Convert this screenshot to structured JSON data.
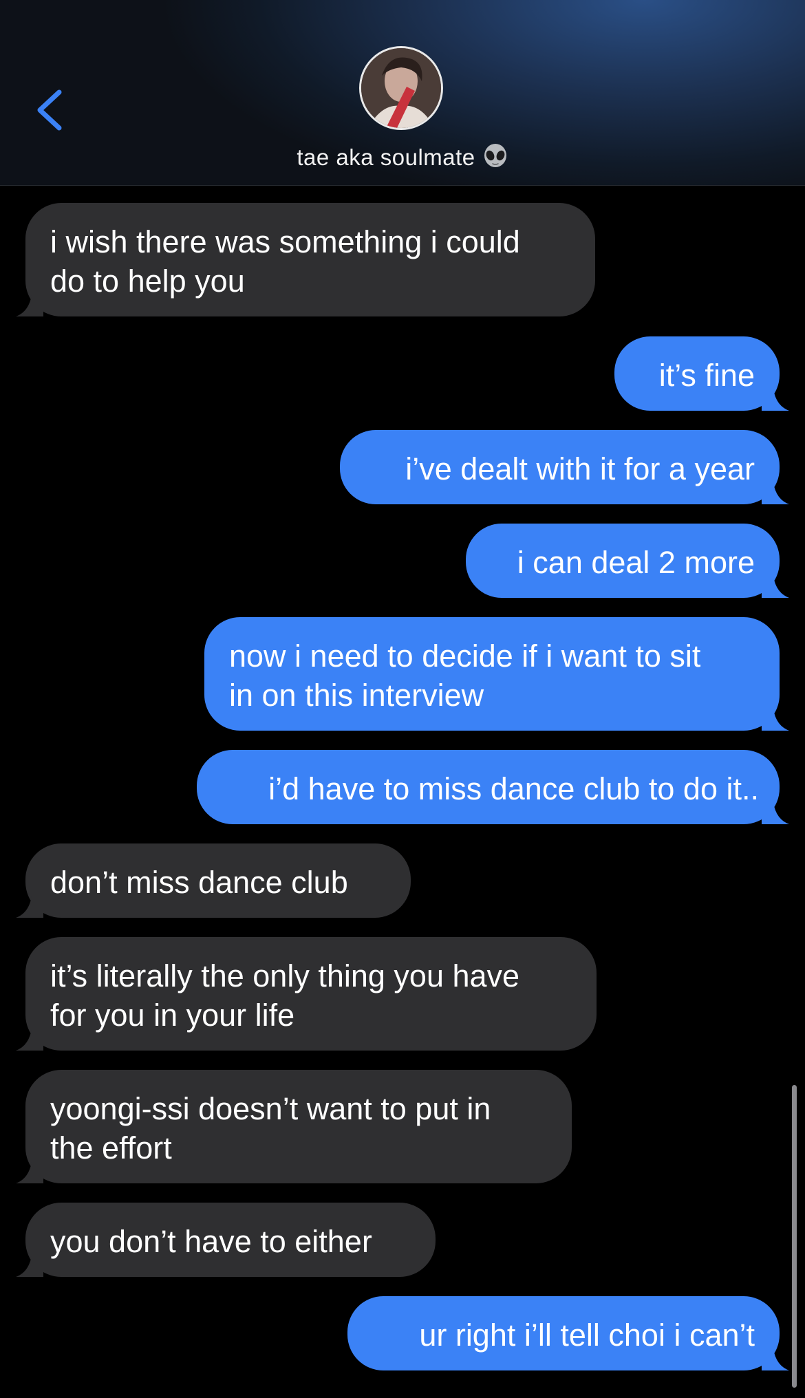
{
  "header": {
    "contact_name": "tae aka soulmate",
    "contact_emoji_icon": "alien-icon",
    "back_icon": "chevron-left-icon",
    "accent_color": "#3b82f6"
  },
  "messages": [
    {
      "direction": "in",
      "text_lines": [
        "i wish there was something i could",
        "do to help you"
      ]
    },
    {
      "direction": "out",
      "text_lines": [
        "it’s fine"
      ]
    },
    {
      "direction": "out",
      "text_lines": [
        "i’ve dealt with it for a year"
      ]
    },
    {
      "direction": "out",
      "text_lines": [
        "i can deal 2 more"
      ]
    },
    {
      "direction": "out",
      "text_lines": [
        "now i need to decide if i want to sit",
        "in on this interview"
      ]
    },
    {
      "direction": "out",
      "text_lines": [
        "i’d have to miss dance club to do it.."
      ]
    },
    {
      "direction": "in",
      "text_lines": [
        "don’t miss dance club"
      ]
    },
    {
      "direction": "in",
      "text_lines": [
        "it’s literally the only thing you have",
        "for you in your life"
      ]
    },
    {
      "direction": "in",
      "text_lines": [
        "yoongi-ssi doesn’t want to put in",
        "the effort"
      ]
    },
    {
      "direction": "in",
      "text_lines": [
        "you don’t have to either"
      ]
    },
    {
      "direction": "out",
      "text_lines": [
        "ur right i’ll tell choi i can’t"
      ]
    }
  ],
  "colors": {
    "incoming_bubble": "#2f2f31",
    "outgoing_bubble": "#3b82f6",
    "background": "#000000"
  }
}
